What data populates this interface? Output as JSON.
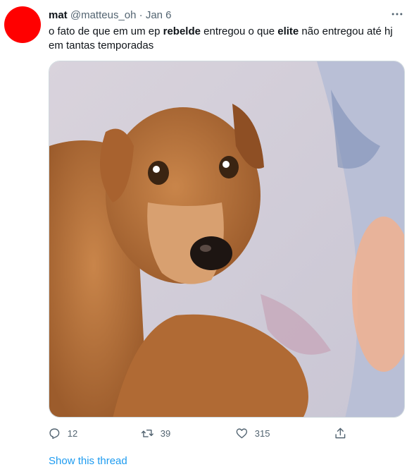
{
  "tweet": {
    "display_name": "mat",
    "handle": "@matteus_oh",
    "separator": "·",
    "date": "Jan 6",
    "text_parts": [
      "o fato de que em um ep ",
      "rebelde",
      " entregou o que ",
      "elite",
      " não entregou até hj em tantas temporadas"
    ],
    "media": {
      "description_icon": "photo-dog"
    },
    "actions": {
      "reply": {
        "icon": "reply-icon",
        "count": "12"
      },
      "retweet": {
        "icon": "retweet-icon",
        "count": "39"
      },
      "like": {
        "icon": "heart-icon",
        "count": "315"
      },
      "share": {
        "icon": "share-icon"
      }
    },
    "show_thread": "Show this thread"
  },
  "colors": {
    "avatar": "#ff0000",
    "text": "#0f1419",
    "muted": "#536471",
    "link": "#1d9bf0"
  }
}
